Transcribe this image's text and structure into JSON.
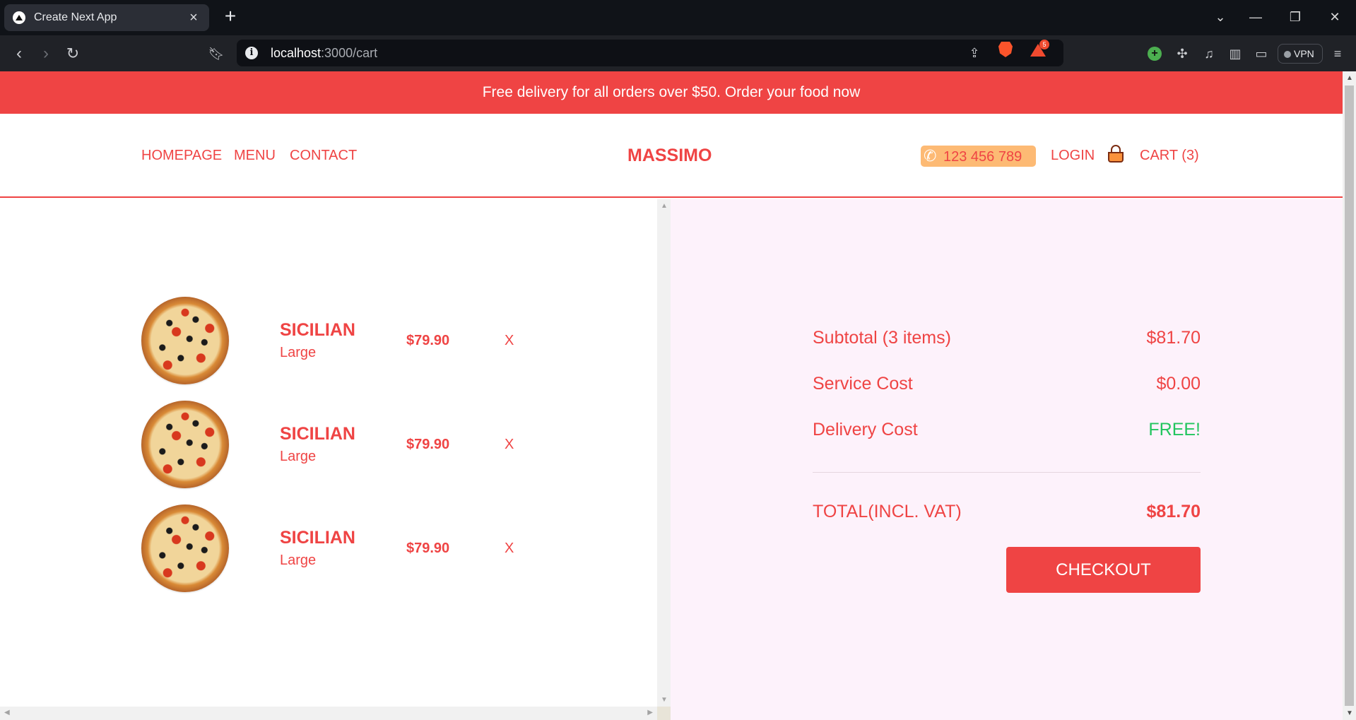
{
  "browser": {
    "tab_title": "Create Next App",
    "url_host": "localhost",
    "url_path": ":3000/cart",
    "rewards_count": "5",
    "vpn_label": "VPN"
  },
  "banner": {
    "text": "Free delivery for all orders over $50. Order your food now"
  },
  "header": {
    "nav": [
      "HOMEPAGE",
      "MENU",
      "CONTACT"
    ],
    "logo": "MASSIMO",
    "phone": "123 456 789",
    "login": "LOGIN",
    "cart": "CART (3)"
  },
  "cart_items": [
    {
      "name": "SICILIAN",
      "size": "Large",
      "price": "$79.90",
      "remove": "X"
    },
    {
      "name": "SICILIAN",
      "size": "Large",
      "price": "$79.90",
      "remove": "X"
    },
    {
      "name": "SICILIAN",
      "size": "Large",
      "price": "$79.90",
      "remove": "X"
    }
  ],
  "summary": {
    "subtotal_label": "Subtotal (3 items)",
    "subtotal_value": "$81.70",
    "service_label": "Service Cost",
    "service_value": "$0.00",
    "delivery_label": "Delivery Cost",
    "delivery_value": "FREE!",
    "total_label": "TOTAL(INCL. VAT)",
    "total_value": "$81.70",
    "checkout_label": "CHECKOUT"
  },
  "colors": {
    "accent": "#ef4444",
    "free": "#22c55e",
    "summary_bg": "#fdf2fb",
    "phone_bg": "#fdba74"
  }
}
